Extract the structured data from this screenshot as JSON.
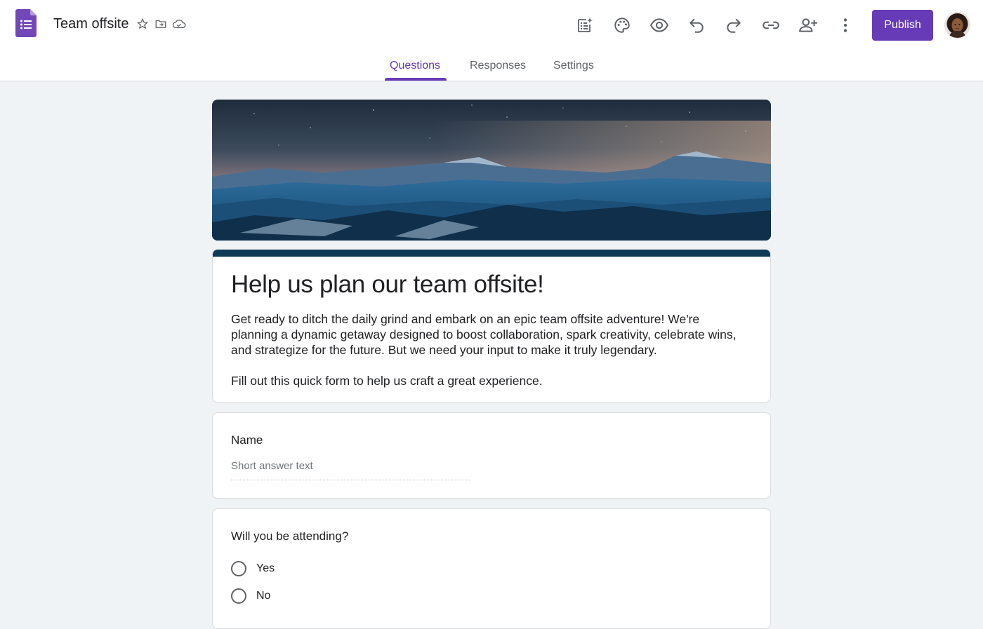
{
  "header": {
    "doc_title": "Team offsite",
    "icons": [
      "star-icon",
      "move-to-folder-icon",
      "cloud-saved-icon"
    ],
    "toolbar": [
      {
        "name": "ai-form-icon"
      },
      {
        "name": "palette-icon"
      },
      {
        "name": "preview-eye-icon"
      },
      {
        "name": "undo-icon"
      },
      {
        "name": "redo-icon"
      },
      {
        "name": "link-icon"
      },
      {
        "name": "add-collaborator-icon"
      },
      {
        "name": "more-vert-icon"
      }
    ],
    "publish_label": "Publish"
  },
  "tabs": [
    {
      "label": "Questions",
      "active": true
    },
    {
      "label": "Responses",
      "active": false
    },
    {
      "label": "Settings",
      "active": false
    }
  ],
  "form": {
    "title": "Help us plan our team offsite!",
    "description": [
      "Get ready to ditch the daily grind and embark on an epic team offsite adventure! We're planning a dynamic getaway designed to boost collaboration, spark creativity, celebrate wins, and strategize for the future. But we need your input to make it truly legendary.",
      "Fill out this quick form to help us craft a great experience."
    ],
    "questions": [
      {
        "title": "Name",
        "placeholder": "Short answer text"
      },
      {
        "title": "Will you be attending?",
        "options": [
          "Yes",
          "No"
        ]
      }
    ]
  },
  "colors": {
    "accent": "#673ab7",
    "title_bar": "#0f3b57",
    "background": "#f0f3f6"
  }
}
